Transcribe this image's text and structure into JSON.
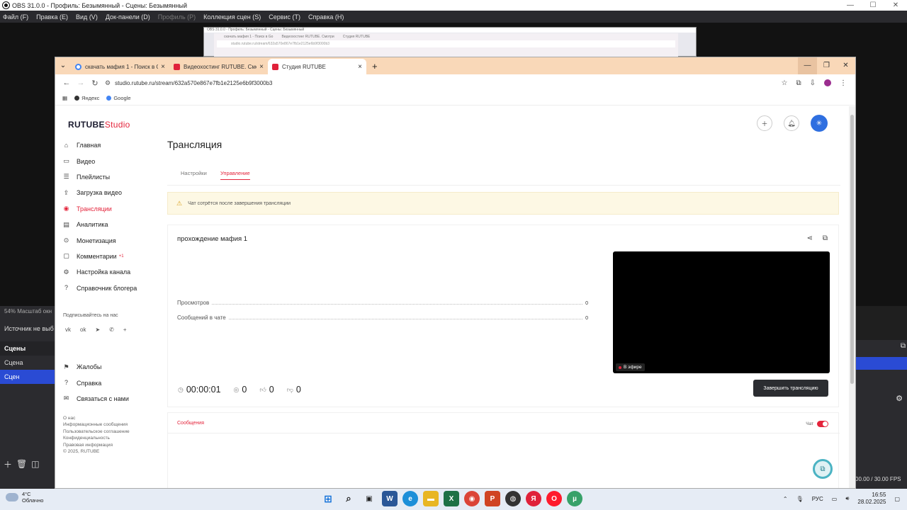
{
  "obs": {
    "title": "OBS 31.0.0 - Профиль: Безымянный - Сцены: Безымянный",
    "menu": [
      "Файл (F)",
      "Правка (E)",
      "Вид (V)",
      "Док-панели (D)",
      "Профиль (P)",
      "Коллекция сцен (S)",
      "Сервис (T)",
      "Справка (H)"
    ],
    "zoom": "54%   Масштаб окн",
    "source_missing": "Источник не выб",
    "scenes_header": "Сцены",
    "scene_1": "Сцена",
    "scene_2": "Сцен",
    "fps": "00.00 / 30.00 FPS"
  },
  "browser": {
    "tabs": [
      {
        "label": "скачать мафия 1 - Поиск в Go",
        "favicon": "google",
        "color": "#4285f4"
      },
      {
        "label": "Видеохостинг RUTUBE. Смотри",
        "favicon": "rutube",
        "color": "#e0213a"
      },
      {
        "label": "Студия RUTUBE",
        "favicon": "rutube",
        "color": "#e0213a"
      }
    ],
    "url": "studio.rutube.ru/stream/632a570e867e7fb1e2125e6b9f3000b3",
    "bookmarks": [
      "Яндекс",
      "Google"
    ],
    "nested_url": "studio.rutube.ru/stream/632a570e867e7fb1e2125e6b9f3000b3"
  },
  "studio": {
    "logo_main": "RUTUBE",
    "logo_studio": "Studio",
    "nav": [
      {
        "label": "Главная",
        "icon": "home-icon",
        "glyph": "⌂"
      },
      {
        "label": "Видео",
        "icon": "video-icon",
        "glyph": "▭"
      },
      {
        "label": "Плейлисты",
        "icon": "playlist-icon",
        "glyph": "☰"
      },
      {
        "label": "Загрузка видео",
        "icon": "upload-icon",
        "glyph": "⇪"
      },
      {
        "label": "Трансляции",
        "icon": "broadcast-icon",
        "glyph": "◉",
        "active": true
      },
      {
        "label": "Аналитика",
        "icon": "analytics-icon",
        "glyph": "▤"
      },
      {
        "label": "Монетизация",
        "icon": "monetization-icon",
        "glyph": "⊙"
      },
      {
        "label": "Комментарии",
        "icon": "comments-icon",
        "glyph": "▢",
        "badge": "+1"
      },
      {
        "label": "Настройка канала",
        "icon": "settings-icon",
        "glyph": "⚙"
      },
      {
        "label": "Справочник блогера",
        "icon": "guide-icon",
        "glyph": "?"
      }
    ],
    "subscribe_label": "Подписывайтесь на нас",
    "socials": [
      "vk-icon",
      "ok-icon",
      "telegram-icon",
      "viber-icon",
      "plus-icon"
    ],
    "nav2": [
      {
        "label": "Жалобы",
        "icon": "flag-icon",
        "glyph": "⚑"
      },
      {
        "label": "Справка",
        "icon": "help-icon",
        "glyph": "?"
      },
      {
        "label": "Связаться с нами",
        "icon": "mail-icon",
        "glyph": "✉"
      }
    ],
    "footer": [
      "О нас",
      "Информационные сообщения",
      "Пользовательское соглашение",
      "Конфиденциальность",
      "Правовая информация",
      "© 2025, RUTUBE"
    ],
    "page_title": "Трансляция",
    "tab_settings": "Настройки",
    "tab_manage": "Управление",
    "warning": "Чат сотрётся после завершения трансляции",
    "stream_title": "прохождение мафия 1",
    "views_label": "Просмотров",
    "views_value": "0",
    "chat_msgs_label": "Сообщений в чате",
    "chat_msgs_value": "0",
    "live_label": "В эфире",
    "timer": "00:00:01",
    "viewers": "0",
    "likes": "0",
    "dislikes": "0",
    "end_button": "Завершить трансляцию",
    "messages_tab": "Сообщения",
    "chat_label": "Чат",
    "chat_enabled": true
  },
  "taskbar": {
    "temp": "4°C",
    "weather": "Облачно",
    "lang": "РУС",
    "time": "16:55",
    "date": "28.02.2025"
  }
}
